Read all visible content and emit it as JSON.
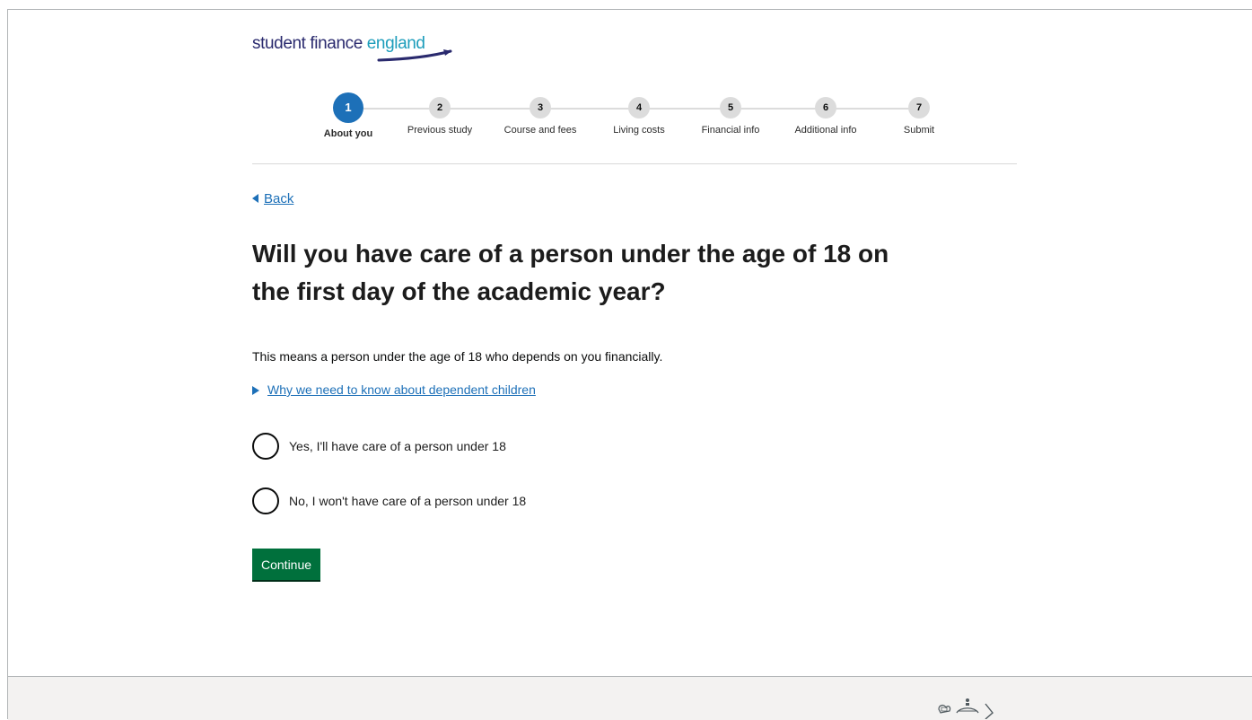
{
  "brand": {
    "part1": "student finance ",
    "part2": "england"
  },
  "stepper": {
    "steps": [
      {
        "number": "1",
        "label": "About you"
      },
      {
        "number": "2",
        "label": "Previous study"
      },
      {
        "number": "3",
        "label": "Course and fees"
      },
      {
        "number": "4",
        "label": "Living costs"
      },
      {
        "number": "5",
        "label": "Financial info"
      },
      {
        "number": "6",
        "label": "Additional info"
      },
      {
        "number": "7",
        "label": "Submit"
      }
    ],
    "current_step": 1
  },
  "back_link": {
    "label": "Back"
  },
  "question": {
    "title": "Will you have care of a person under the age of 18 on the first day of the academic year?",
    "hint": "This means a person under the age of 18 who depends on you financially.",
    "details_summary": "Why we need to know about dependent children"
  },
  "options": [
    {
      "label": "Yes, I'll have care of a person under 18",
      "selected": false
    },
    {
      "label": "No, I won't have care of a person under 18",
      "selected": false
    }
  ],
  "actions": {
    "continue_label": "Continue"
  },
  "colors": {
    "brand_navy": "#2a2a6e",
    "brand_teal": "#1d9dbb",
    "link_blue": "#1d70b8",
    "button_green": "#00703c",
    "footer_grey": "#f3f2f1"
  }
}
